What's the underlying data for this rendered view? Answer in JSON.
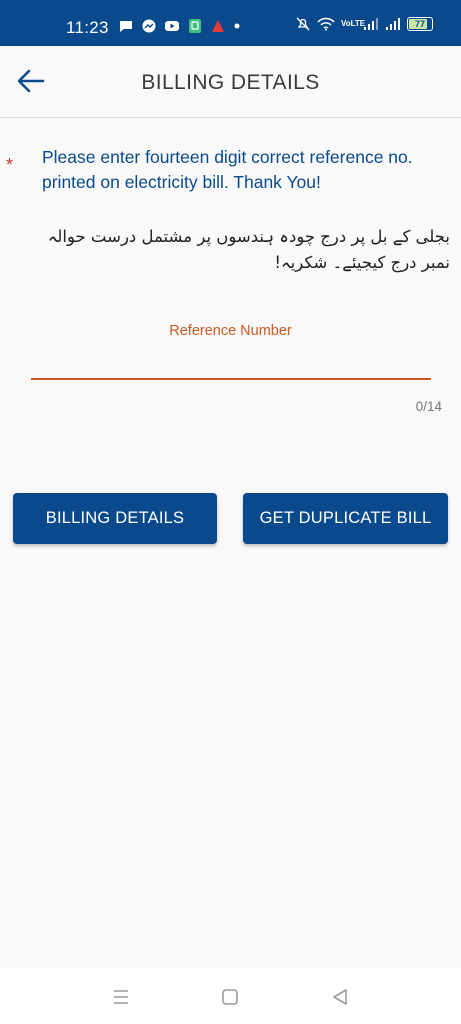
{
  "status_bar": {
    "time": "11:23",
    "battery": "77",
    "network_label": "VoLTE",
    "icons_left": [
      "chat-icon",
      "messenger-icon",
      "youtube-icon",
      "app-icon",
      "red-app-icon",
      "dot-icon"
    ],
    "icons_right": [
      "mute-icon",
      "wifi-icon",
      "volte-icon",
      "signal-icon",
      "signal-icon",
      "battery-icon"
    ],
    "colors": {
      "background": "#0a4a8c",
      "foreground": "#ffffff"
    }
  },
  "app_bar": {
    "title": "BILLING DETAILS",
    "back_icon": "arrow-left-icon"
  },
  "notice": {
    "required_mark": "*",
    "english": "Please enter fourteen digit correct reference no. printed on electricity bill. Thank You!",
    "urdu": "بجلی کے بل پر درج چودہ ہندسوں پر مشتمل درست حوالہ نمبر درج کیجیئے۔ شکریہ!"
  },
  "reference_field": {
    "label": "Reference Number",
    "value": "",
    "counter": "0/14",
    "accent_color": "#cc5a22"
  },
  "buttons": {
    "billing_details": "BILLING DETAILS",
    "get_duplicate_bill": "GET DUPLICATE BILL",
    "color": "#0a4a8c"
  },
  "nav_bar": {
    "items": [
      "menu-icon",
      "home-icon",
      "back-icon"
    ]
  }
}
